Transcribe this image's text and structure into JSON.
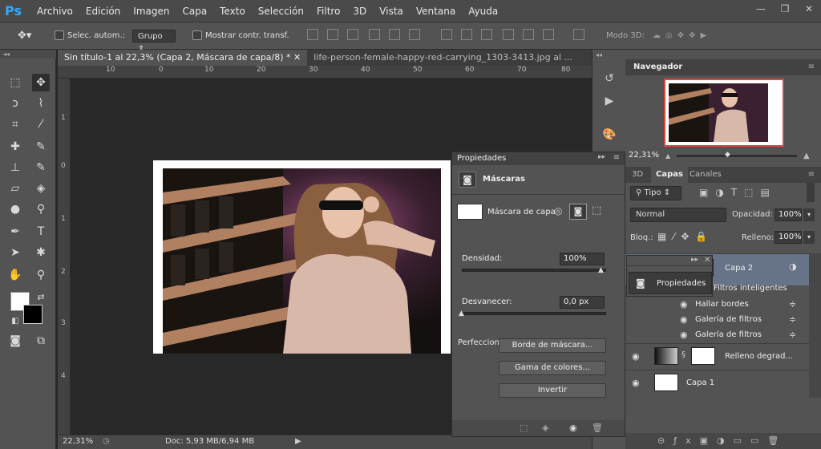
{
  "app": {
    "logo": "Ps"
  },
  "menu": [
    "Archivo",
    "Edición",
    "Imagen",
    "Capa",
    "Texto",
    "Selección",
    "Filtro",
    "3D",
    "Vista",
    "Ventana",
    "Ayuda"
  ],
  "window": {
    "minimize": "—",
    "restore": "❐",
    "close": "✕"
  },
  "options": {
    "auto_select": "Selec. autom.:",
    "group": "Grupo",
    "show_transform": "Mostrar contr. transf.",
    "mode3d": "Modo 3D:"
  },
  "tabs": [
    "Sin título-1 al 22,3% (Capa 2, Máscara de capa/8) *",
    "life-person-female-happy-red-carrying_1303-3413.jpg al ..."
  ],
  "ruler_h": [
    "10",
    "0",
    "10",
    "20",
    "30",
    "40",
    "50",
    "60",
    "70",
    "80"
  ],
  "ruler_v": [
    "1",
    "0",
    "1",
    "2",
    "3",
    "4"
  ],
  "status": {
    "zoom": "22,31%",
    "doc": "Doc: 5,93 MB/6,94 MB"
  },
  "navigator": {
    "title": "Navegador",
    "zoom": "22,31%"
  },
  "layers_panel": {
    "tabs": [
      "3D",
      "Capas",
      "Canales"
    ],
    "filter": "Tipo",
    "blend": "Normal",
    "opacity_label": "Opacidad:",
    "opacity": "100%",
    "lock_label": "Bloq.:",
    "fill_label": "Relleno:",
    "fill": "100%",
    "layers": [
      {
        "name": "Capa 2"
      },
      {
        "name": "Filtros inteligentes"
      },
      {
        "name": "Hallar bordes"
      },
      {
        "name": "Galería de filtros"
      },
      {
        "name": "Galería de filtros"
      },
      {
        "name": "Relleno degrad..."
      },
      {
        "name": "Capa 1"
      }
    ]
  },
  "properties": {
    "title": "Propiedades",
    "section": "Máscaras",
    "mask_label": "Máscara de capa",
    "density_label": "Densidad:",
    "density": "100%",
    "feather_label": "Desvanecer:",
    "feather": "0,0 px",
    "refine_label": "Perfecciona",
    "btn_edge": "Borde de máscara...",
    "btn_color": "Gama de colores...",
    "btn_invert": "Invertir"
  },
  "float_properties": {
    "title": "Propiedades"
  },
  "colors": {
    "accent": "#31a8ff",
    "nav_border": "#dd4444"
  }
}
